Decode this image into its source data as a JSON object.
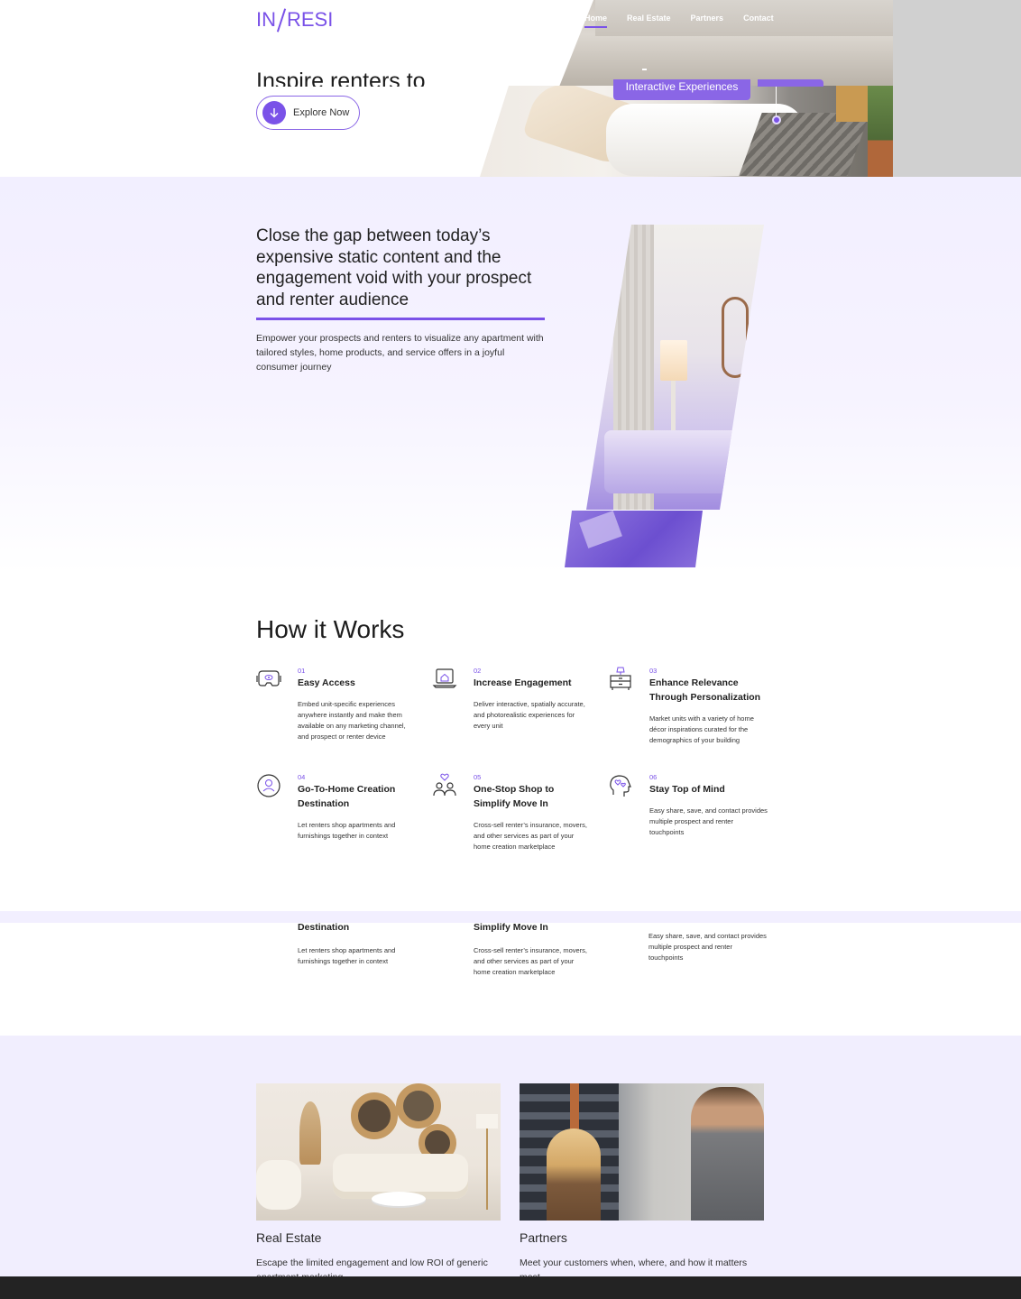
{
  "brand": {
    "left": "IN",
    "right": "RESI",
    "accent": "#7a52e8"
  },
  "nav": {
    "items": [
      "Home",
      "Real Estate",
      "Partners",
      "Contact"
    ],
    "active": "Home"
  },
  "hero": {
    "title": "Inspire renters to",
    "badge": "Interactive Experiences",
    "cta_label": "Explore Now",
    "cta_icon": "arrow-down-icon"
  },
  "gap": {
    "title": "Close the gap between today’s expensive static content and the engagement void with your prospect and renter audience",
    "description": "Empower your prospects and renters to visualize any apartment with tailored styles, home products, and service offers in a joyful consumer journey"
  },
  "how": {
    "title": "How it Works",
    "steps": [
      {
        "num": "01",
        "title": "Easy Access",
        "desc": "Embed unit-specific experiences anywhere instantly and make them available on any marketing channel, and prospect or renter device",
        "icon": "vr-headset-icon"
      },
      {
        "num": "02",
        "title": "Increase Engagement",
        "desc": "Deliver interactive, spatially accurate, and photorealistic experiences for every unit",
        "icon": "laptop-home-icon"
      },
      {
        "num": "03",
        "title": "Enhance Relevance Through Personalization",
        "desc": "Market units with a variety of home décor inspirations curated for the demographics of your building",
        "icon": "dresser-lamp-icon"
      },
      {
        "num": "04",
        "title": "Go-To-Home Creation Destination",
        "desc": "Let renters shop apartments and furnishings together in context",
        "icon": "user-circle-icon"
      },
      {
        "num": "05",
        "title": "One-Stop Shop to Simplify Move In",
        "desc": "Cross-sell renter’s insurance, movers, and other services as part of your home creation marketplace",
        "icon": "people-heart-icon"
      },
      {
        "num": "06",
        "title": "Stay Top of Mind",
        "desc": "Easy share, save, and contact provides multiple prospect and renter touchpoints",
        "icon": "head-hearts-icon"
      }
    ],
    "repeat": {
      "title_a": "Destination",
      "desc_a": "Let renters shop apartments and furnishings together in context",
      "title_b": "Simplify Move In",
      "desc_b": "Cross-sell renter’s insurance, movers, and other services as part of your home creation marketplace",
      "desc_c": "Easy share, save, and contact provides multiple prospect and renter touchpoints"
    }
  },
  "cards": [
    {
      "title": "Real Estate",
      "desc": "Escape the limited engagement and low ROI of generic apartment marketing"
    },
    {
      "title": "Partners",
      "desc": "Meet your customers when, where, and how it matters most"
    }
  ]
}
